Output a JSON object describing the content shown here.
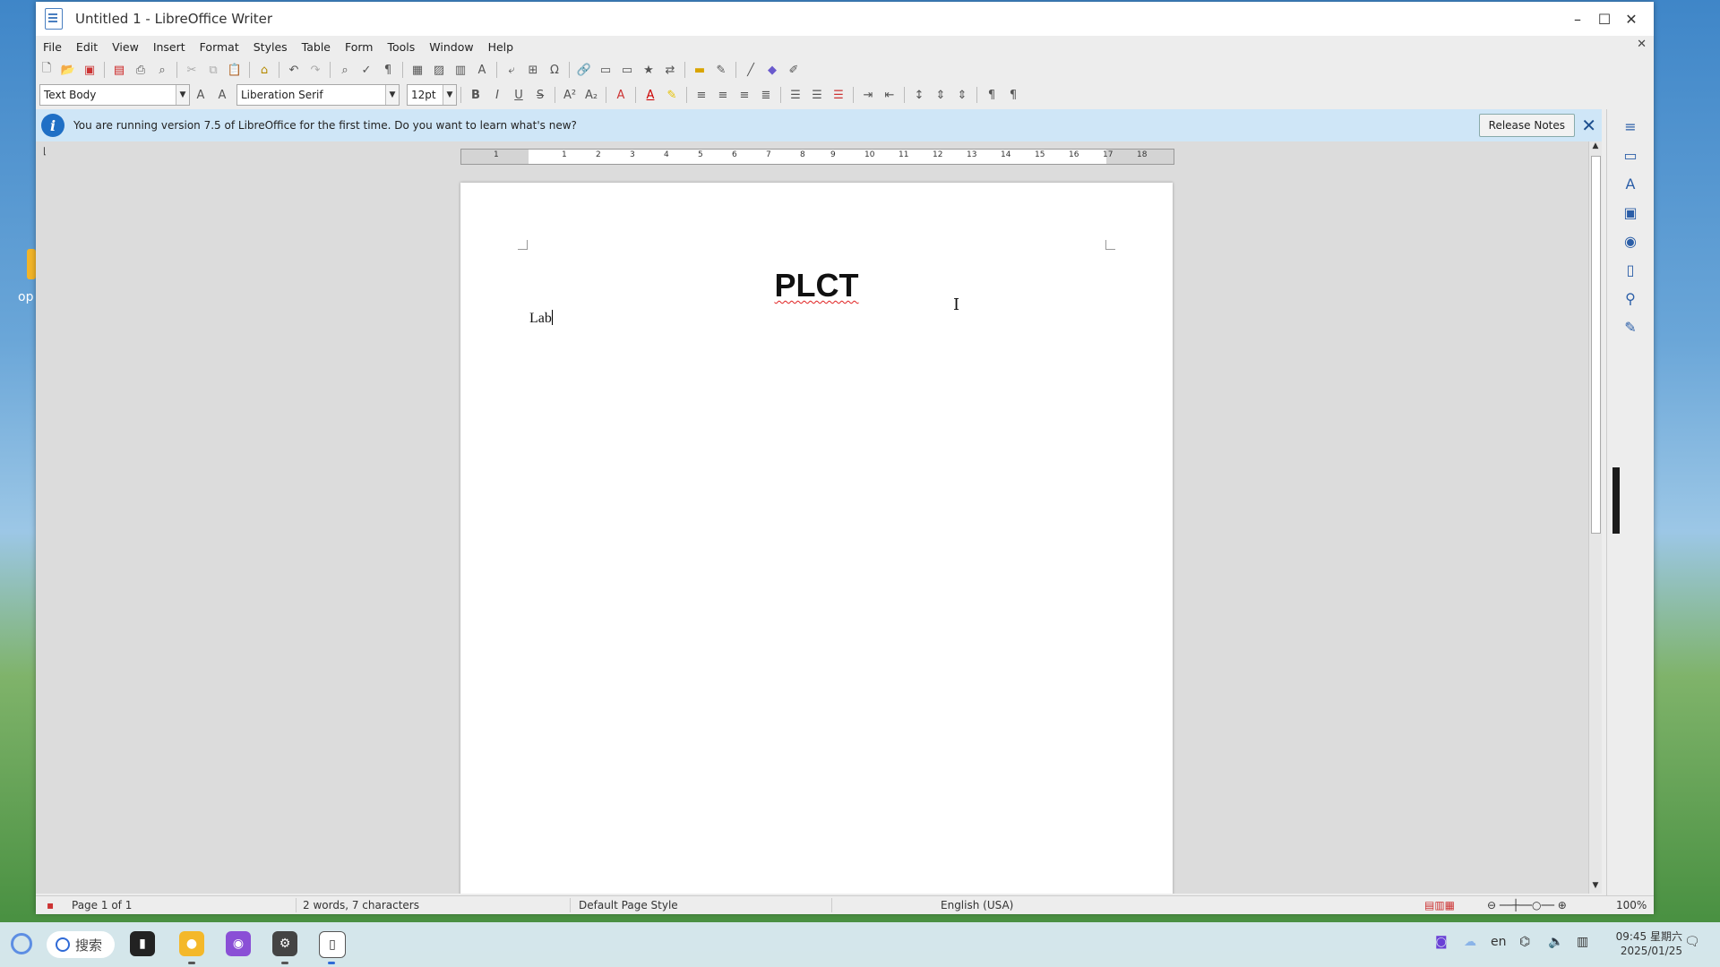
{
  "desktop": {
    "partial_label": "op"
  },
  "window": {
    "title": "Untitled 1 - LibreOffice Writer",
    "controls": {
      "minimize": "–",
      "maximize": "☐",
      "close": "✕"
    }
  },
  "menu": [
    "File",
    "Edit",
    "View",
    "Insert",
    "Format",
    "Styles",
    "Table",
    "Form",
    "Tools",
    "Window",
    "Help"
  ],
  "formatting": {
    "paragraph_style": "Text Body",
    "font_name": "Liberation Serif",
    "font_size": "12pt",
    "bold": "B",
    "italic": "I",
    "underline": "U",
    "strike": "S"
  },
  "infobar": {
    "message": "You are running version 7.5 of LibreOffice for the first time. Do you want to learn what's new?",
    "button": "Release Notes",
    "close": "✕"
  },
  "ruler": {
    "numbers": [
      "1",
      "1",
      "2",
      "3",
      "4",
      "5",
      "6",
      "7",
      "8",
      "9",
      "10",
      "11",
      "12",
      "13",
      "14",
      "15",
      "16",
      "17",
      "18"
    ]
  },
  "document": {
    "heading": "PLCT",
    "body": "Lab"
  },
  "status": {
    "page": "Page 1 of 1",
    "words": "2 words, 7 characters",
    "page_style": "Default Page Style",
    "language": "English (USA)",
    "zoom": "100%"
  },
  "taskbar": {
    "search_label": "搜索",
    "lang": "en",
    "time": "09:45 星期六",
    "date": "2025/01/25"
  }
}
